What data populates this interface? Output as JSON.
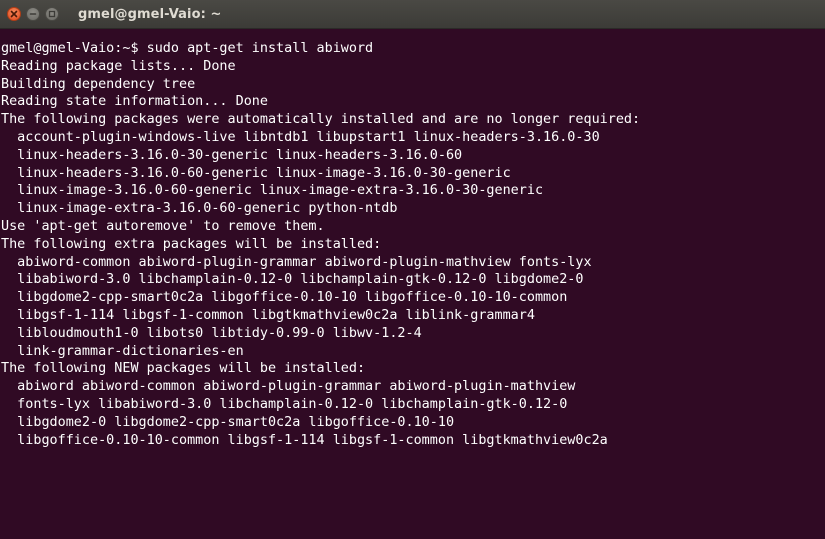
{
  "window": {
    "title": "gmel@gmel-Vaio: ~",
    "controls": {
      "close_icon": "close-icon",
      "minimize_icon": "minimize-icon",
      "maximize_icon": "maximize-icon"
    },
    "colors": {
      "background": "#300a24",
      "text": "#ffffff",
      "titlebar": "#3c3b37",
      "close_button": "#e0491f"
    }
  },
  "terminal": {
    "lines": [
      "gmel@gmel-Vaio:~$ sudo apt-get install abiword",
      "Reading package lists... Done",
      "Building dependency tree",
      "Reading state information... Done",
      "The following packages were automatically installed and are no longer required:",
      "  account-plugin-windows-live libntdb1 libupstart1 linux-headers-3.16.0-30",
      "  linux-headers-3.16.0-30-generic linux-headers-3.16.0-60",
      "  linux-headers-3.16.0-60-generic linux-image-3.16.0-30-generic",
      "  linux-image-3.16.0-60-generic linux-image-extra-3.16.0-30-generic",
      "  linux-image-extra-3.16.0-60-generic python-ntdb",
      "Use 'apt-get autoremove' to remove them.",
      "The following extra packages will be installed:",
      "  abiword-common abiword-plugin-grammar abiword-plugin-mathview fonts-lyx",
      "  libabiword-3.0 libchamplain-0.12-0 libchamplain-gtk-0.12-0 libgdome2-0",
      "  libgdome2-cpp-smart0c2a libgoffice-0.10-10 libgoffice-0.10-10-common",
      "  libgsf-1-114 libgsf-1-common libgtkmathview0c2a liblink-grammar4",
      "  libloudmouth1-0 libots0 libtidy-0.99-0 libwv-1.2-4",
      "  link-grammar-dictionaries-en",
      "The following NEW packages will be installed:",
      "  abiword abiword-common abiword-plugin-grammar abiword-plugin-mathview",
      "  fonts-lyx libabiword-3.0 libchamplain-0.12-0 libchamplain-gtk-0.12-0",
      "  libgdome2-0 libgdome2-cpp-smart0c2a libgoffice-0.10-10",
      "  libgoffice-0.10-10-common libgsf-1-114 libgsf-1-common libgtkmathview0c2a"
    ]
  }
}
